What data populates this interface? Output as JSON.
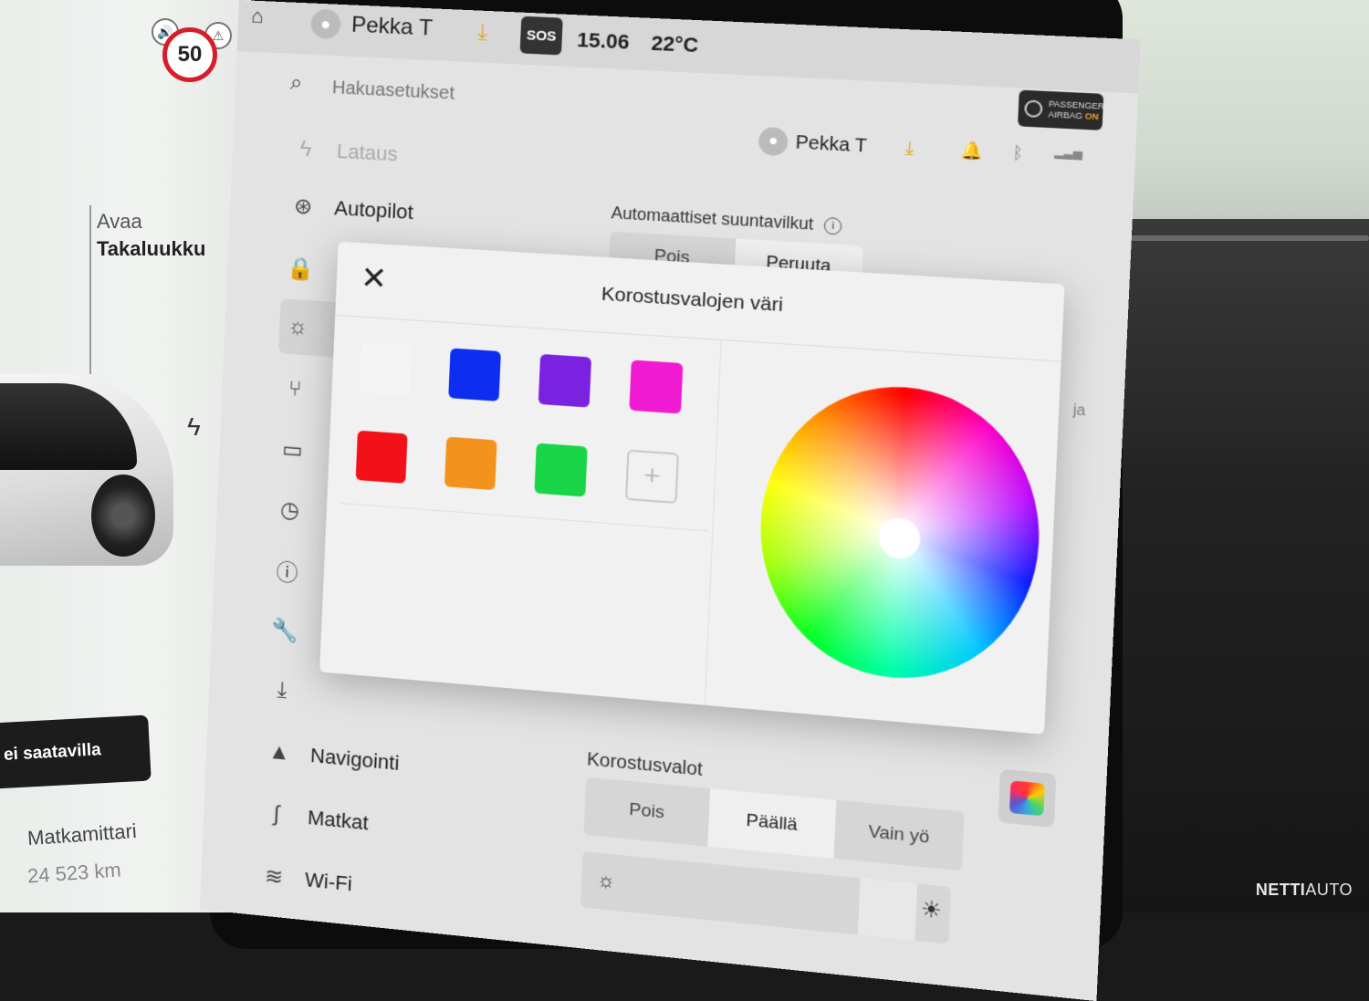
{
  "left_panel": {
    "speed_limit": "50",
    "trunk_label_1": "Avaa",
    "trunk_label_2": "Takaluukku",
    "charging_status": "ei saatavilla",
    "odometer_label": "Matkamittari",
    "odometer_value": "24 523 km"
  },
  "status_bar": {
    "user_name": "Pekka T",
    "sos_label": "SOS",
    "time": "15.06",
    "temperature": "22°C",
    "airbag_line1": "PASSENGER",
    "airbag_line2": "AIRBAG",
    "airbag_state": "ON"
  },
  "search": {
    "placeholder": "Hakuasetukset"
  },
  "header_right": {
    "user_name": "Pekka T"
  },
  "menu": {
    "items": [
      {
        "label": "Lataus",
        "icon": "bolt-icon"
      },
      {
        "label": "Autopilot",
        "icon": "steering-wheel-icon"
      },
      {
        "label": "",
        "icon": "lock-icon"
      },
      {
        "label": "",
        "icon": "sun-icon"
      },
      {
        "label": "",
        "icon": "seat-icon"
      },
      {
        "label": "",
        "icon": "display-icon"
      },
      {
        "label": "",
        "icon": "schedule-icon"
      },
      {
        "label": "",
        "icon": "alert-icon"
      },
      {
        "label": "",
        "icon": "wrench-icon"
      },
      {
        "label": "",
        "icon": "download-icon"
      },
      {
        "label": "Navigointi",
        "icon": "navigation-icon"
      },
      {
        "label": "Matkat",
        "icon": "trips-icon"
      },
      {
        "label": "Wi-Fi",
        "icon": "wifi-icon"
      }
    ]
  },
  "auto_signals": {
    "label": "Automaattiset suuntavilkut",
    "options": [
      "Pois",
      "Peruuta"
    ],
    "selected": "Peruuta"
  },
  "hint": "ja",
  "accent_lights": {
    "label": "Korostusvalot",
    "options": [
      "Pois",
      "Päällä",
      "Vain yö"
    ],
    "selected": "Päällä"
  },
  "modal": {
    "title": "Korostusvalojen väri",
    "close_label": "✕",
    "add_label": "+",
    "swatches": [
      "#f4f4f4",
      "#0d2ef0",
      "#7a22e0",
      "#f01ad2",
      "#f21118",
      "#f3921c",
      "#18d648"
    ]
  },
  "watermark": {
    "bold": "NETTI",
    "thin": "AUTO"
  }
}
